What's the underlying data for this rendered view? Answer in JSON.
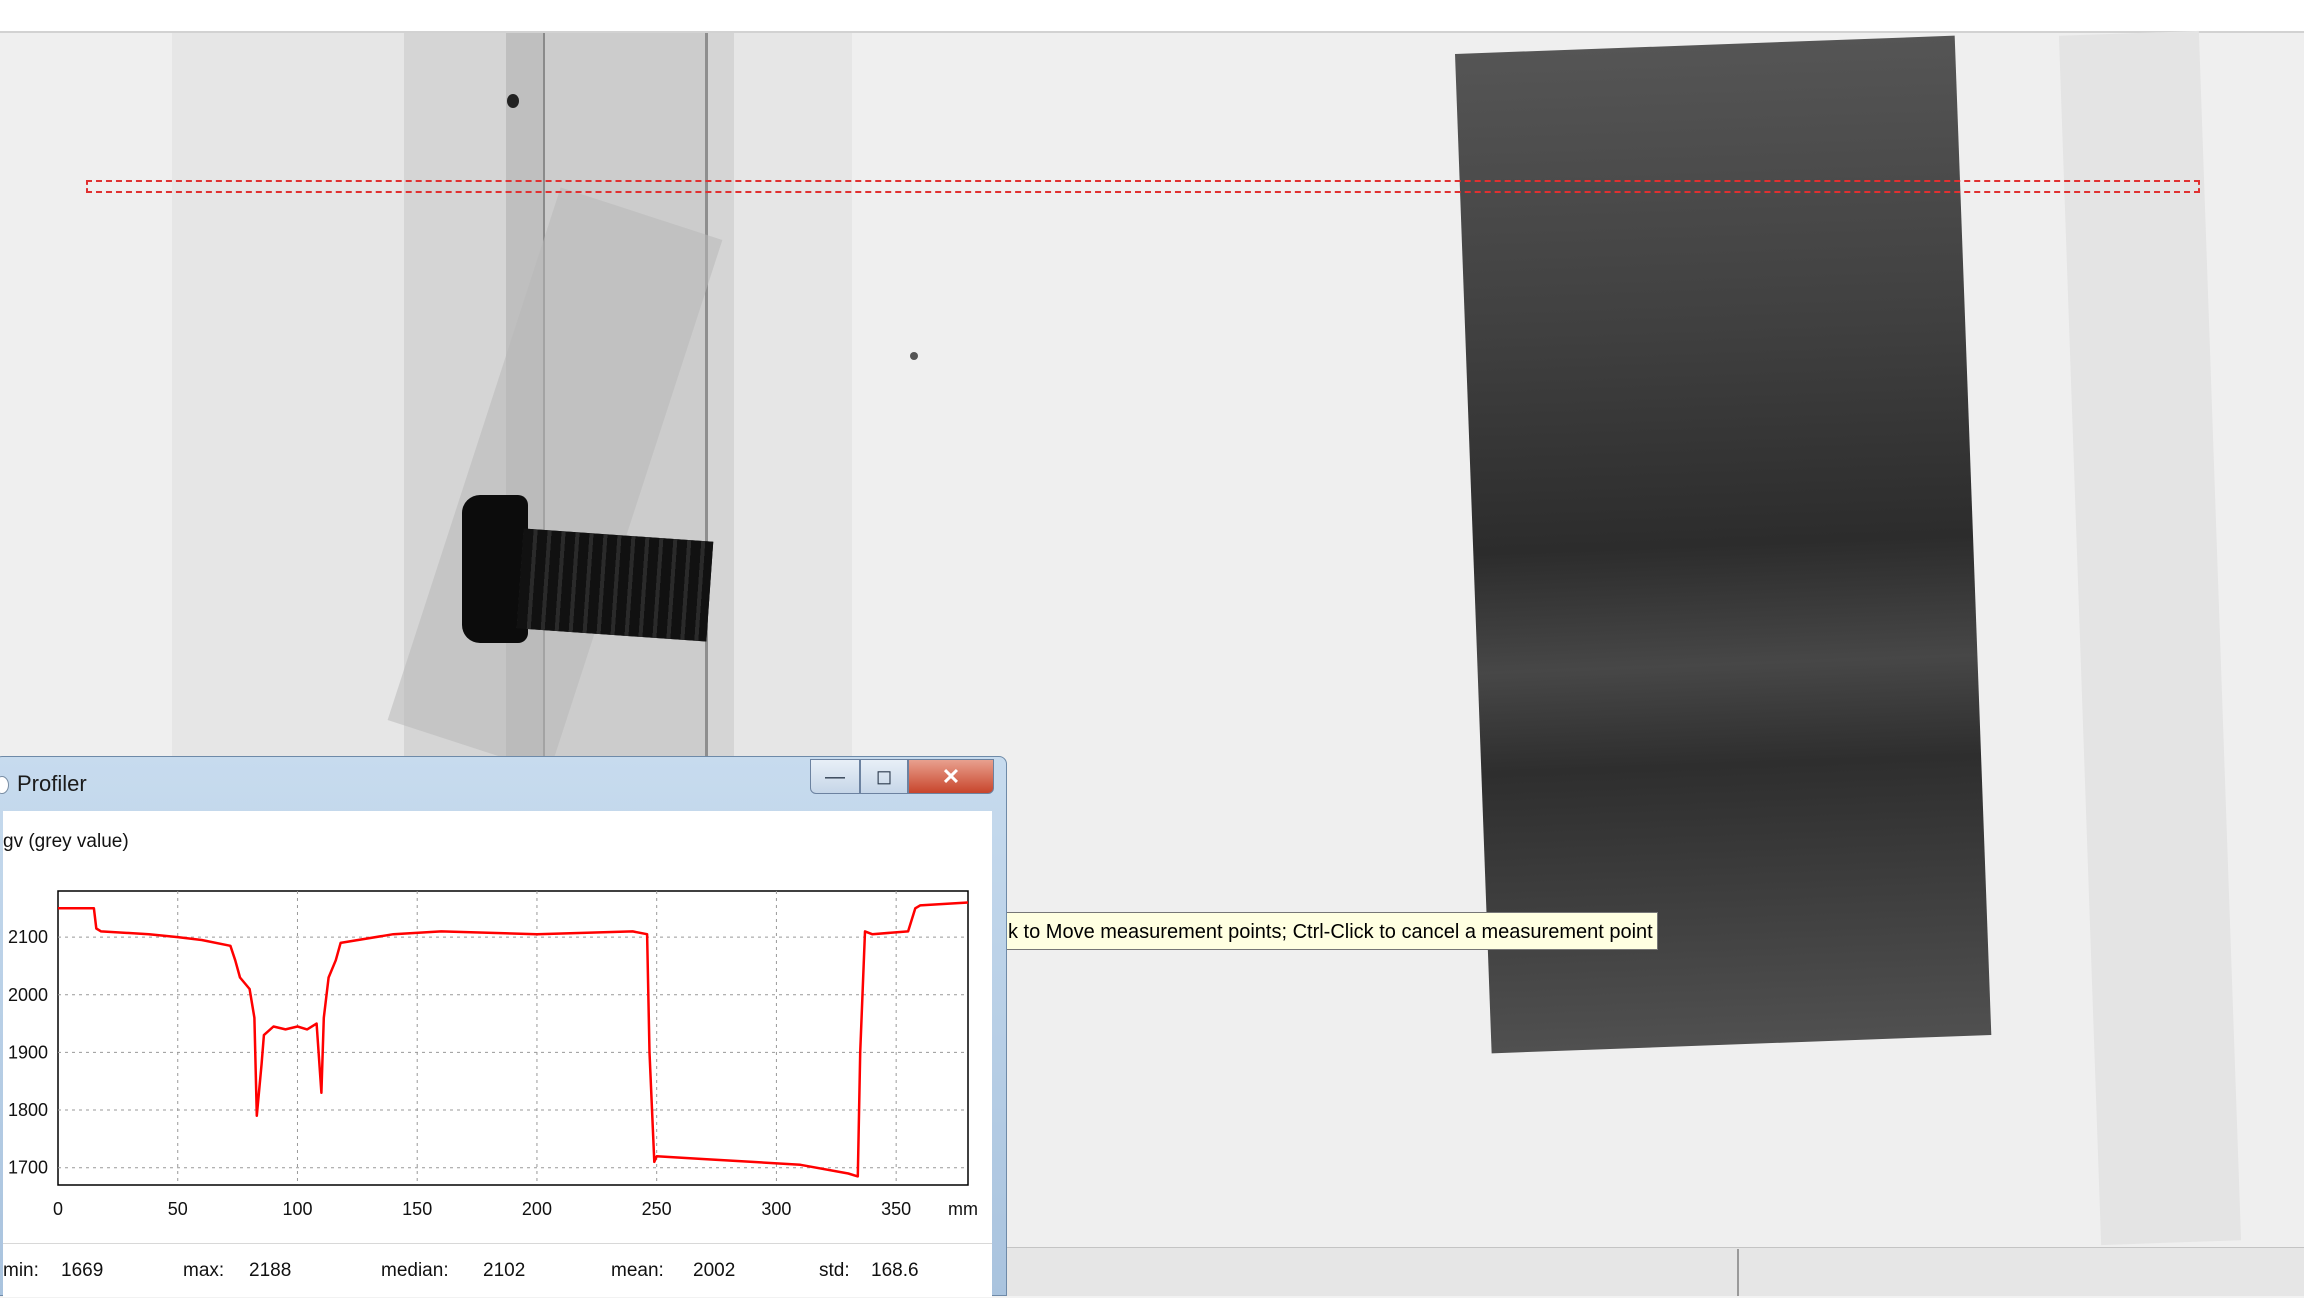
{
  "profiler": {
    "title": "Profiler",
    "y_axis_label": "gv (grey value)",
    "x_unit": "mm",
    "window_buttons": {
      "minimize": "—",
      "maximize": "◻",
      "close": "✕"
    },
    "stats": [
      {
        "label": "min:",
        "value": "1669"
      },
      {
        "label": "max:",
        "value": "2188"
      },
      {
        "label": "median:",
        "value": "2102"
      },
      {
        "label": "mean:",
        "value": "2002"
      },
      {
        "label": "std:",
        "value": "168.6"
      }
    ]
  },
  "tooltip": {
    "text": "k to Move measurement points; Ctrl-Click to cancel a measurement point"
  },
  "colors": {
    "profile_line": "#ff0000",
    "selection_rect": "#e03030",
    "tooltip_bg": "#ffffe1"
  },
  "chart_data": {
    "type": "line",
    "title": "",
    "xlabel": "mm",
    "ylabel": "gv (grey value)",
    "x_ticks": [
      0,
      50,
      100,
      150,
      200,
      250,
      300,
      350
    ],
    "y_ticks": [
      1700,
      1800,
      1900,
      2000,
      2100
    ],
    "xlim": [
      0,
      380
    ],
    "ylim": [
      1670,
      2180
    ],
    "grid": true,
    "series": [
      {
        "x": [
          0,
          15,
          16,
          18,
          38,
          50,
          60,
          72,
          74,
          76,
          80,
          82,
          83,
          85,
          86,
          90,
          95,
          100,
          104,
          108,
          110,
          111,
          113,
          116,
          118,
          140,
          160,
          200,
          240,
          246,
          247,
          249,
          250,
          270,
          290,
          310,
          330,
          334,
          335,
          337,
          340,
          355,
          358,
          360,
          380
        ],
        "y": [
          2150,
          2150,
          2115,
          2110,
          2105,
          2100,
          2095,
          2085,
          2060,
          2030,
          2010,
          1960,
          1790,
          1880,
          1930,
          1945,
          1940,
          1945,
          1940,
          1950,
          1830,
          1960,
          2030,
          2060,
          2090,
          2105,
          2110,
          2105,
          2110,
          2105,
          1900,
          1710,
          1720,
          1715,
          1710,
          1705,
          1690,
          1685,
          1900,
          2110,
          2105,
          2110,
          2150,
          2155,
          2160
        ]
      }
    ]
  }
}
